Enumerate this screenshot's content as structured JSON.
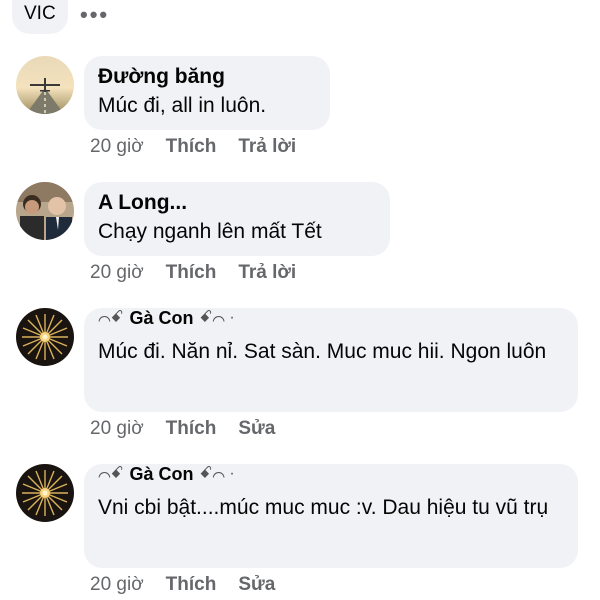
{
  "header": {
    "chip_label": "VIC",
    "more_label": "•••"
  },
  "comments": [
    {
      "author": "Đường băng",
      "text": "Múc đi, all in luôn.",
      "time": "20 giờ",
      "like_label": "Thích",
      "action2_label": "Trả lời",
      "avatar_icon": "airplane-runway-avatar"
    },
    {
      "author": "A Long...",
      "text": "Chạy nganh lên mất Tết",
      "time": "20 giờ",
      "like_label": "Thích",
      "action2_label": "Trả lời",
      "avatar_icon": "people-photo-avatar"
    },
    {
      "author": "Gà Con",
      "text": "Múc đi. Năn nỉ. Sat sàn. Muc muc hii. Ngon luôn",
      "time": "20 giờ",
      "like_label": "Thích",
      "action2_label": "Sửa",
      "avatar_icon": "starburst-avatar"
    },
    {
      "author": "Gà Con",
      "text": "Vni cbi bật....múc muc muc :v. Dau hiệu tu vũ trụ",
      "time": "20 giờ",
      "like_label": "Thích",
      "action2_label": "Sửa",
      "avatar_icon": "starburst-avatar"
    }
  ],
  "colors": {
    "bubble": "#f0f2f5",
    "meta": "#65676b",
    "text": "#050505"
  }
}
